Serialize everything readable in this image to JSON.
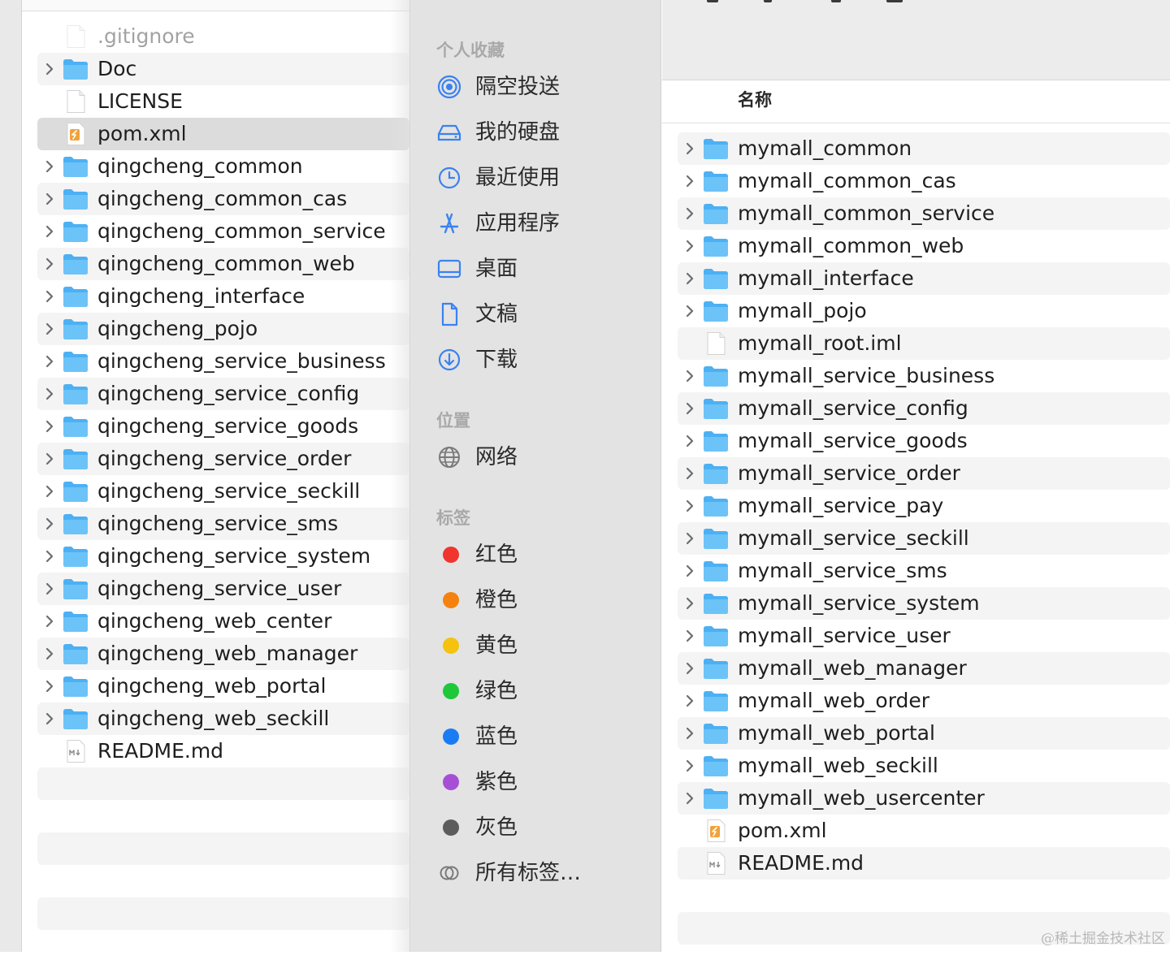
{
  "left_list": {
    "rows": [
      {
        "name": ".gitignore",
        "type": "file",
        "dim": true
      },
      {
        "name": "Doc",
        "type": "folder"
      },
      {
        "name": "LICENSE",
        "type": "file"
      },
      {
        "name": "pom.xml",
        "type": "xml",
        "selected": true
      },
      {
        "name": "qingcheng_common",
        "type": "folder"
      },
      {
        "name": "qingcheng_common_cas",
        "type": "folder"
      },
      {
        "name": "qingcheng_common_service",
        "type": "folder"
      },
      {
        "name": "qingcheng_common_web",
        "type": "folder"
      },
      {
        "name": "qingcheng_interface",
        "type": "folder"
      },
      {
        "name": "qingcheng_pojo",
        "type": "folder"
      },
      {
        "name": "qingcheng_service_business",
        "type": "folder"
      },
      {
        "name": "qingcheng_service_config",
        "type": "folder"
      },
      {
        "name": "qingcheng_service_goods",
        "type": "folder"
      },
      {
        "name": "qingcheng_service_order",
        "type": "folder"
      },
      {
        "name": "qingcheng_service_seckill",
        "type": "folder"
      },
      {
        "name": "qingcheng_service_sms",
        "type": "folder"
      },
      {
        "name": "qingcheng_service_system",
        "type": "folder"
      },
      {
        "name": "qingcheng_service_user",
        "type": "folder"
      },
      {
        "name": "qingcheng_web_center",
        "type": "folder"
      },
      {
        "name": "qingcheng_web_manager",
        "type": "folder"
      },
      {
        "name": "qingcheng_web_portal",
        "type": "folder"
      },
      {
        "name": "qingcheng_web_seckill",
        "type": "folder"
      },
      {
        "name": "README.md",
        "type": "md"
      }
    ]
  },
  "sidebar": {
    "favorites_title": "个人收藏",
    "favorites": [
      {
        "label": "隔空投送",
        "icon": "airdrop-icon"
      },
      {
        "label": "我的硬盘",
        "icon": "hard-drive-icon"
      },
      {
        "label": "最近使用",
        "icon": "clock-icon"
      },
      {
        "label": "应用程序",
        "icon": "applications-icon"
      },
      {
        "label": "桌面",
        "icon": "desktop-icon"
      },
      {
        "label": "文稿",
        "icon": "document-icon"
      },
      {
        "label": "下载",
        "icon": "download-icon"
      }
    ],
    "locations_title": "位置",
    "locations": [
      {
        "label": "网络",
        "icon": "network-globe-icon"
      }
    ],
    "tags_title": "标签",
    "tags": [
      {
        "label": "红色",
        "color": "#f0342e"
      },
      {
        "label": "橙色",
        "color": "#f5820f"
      },
      {
        "label": "黄色",
        "color": "#f5c20f"
      },
      {
        "label": "绿色",
        "color": "#1ec83a"
      },
      {
        "label": "蓝色",
        "color": "#1a7cf5"
      },
      {
        "label": "紫色",
        "color": "#a64fd6"
      },
      {
        "label": "灰色",
        "color": "#5c5c5c"
      }
    ],
    "all_tags_label": "所有标签…"
  },
  "right_list": {
    "column_header": "名称",
    "rows": [
      {
        "name": "mymall_common",
        "type": "folder"
      },
      {
        "name": "mymall_common_cas",
        "type": "folder"
      },
      {
        "name": "mymall_common_service",
        "type": "folder"
      },
      {
        "name": "mymall_common_web",
        "type": "folder"
      },
      {
        "name": "mymall_interface",
        "type": "folder"
      },
      {
        "name": "mymall_pojo",
        "type": "folder"
      },
      {
        "name": "mymall_root.iml",
        "type": "file"
      },
      {
        "name": "mymall_service_business",
        "type": "folder"
      },
      {
        "name": "mymall_service_config",
        "type": "folder"
      },
      {
        "name": "mymall_service_goods",
        "type": "folder"
      },
      {
        "name": "mymall_service_order",
        "type": "folder"
      },
      {
        "name": "mymall_service_pay",
        "type": "folder"
      },
      {
        "name": "mymall_service_seckill",
        "type": "folder"
      },
      {
        "name": "mymall_service_sms",
        "type": "folder"
      },
      {
        "name": "mymall_service_system",
        "type": "folder"
      },
      {
        "name": "mymall_service_user",
        "type": "folder"
      },
      {
        "name": "mymall_web_manager",
        "type": "folder"
      },
      {
        "name": "mymall_web_order",
        "type": "folder"
      },
      {
        "name": "mymall_web_portal",
        "type": "folder"
      },
      {
        "name": "mymall_web_seckill",
        "type": "folder"
      },
      {
        "name": "mymall_web_usercenter",
        "type": "folder"
      },
      {
        "name": "pom.xml",
        "type": "xml"
      },
      {
        "name": "README.md",
        "type": "md"
      }
    ]
  },
  "watermark": "@稀土掘金技术社区",
  "colors": {
    "folder_blue": "#4db0f3",
    "sidebar_icon_blue": "#3a82f0",
    "selected_row": "#dcdcdc",
    "stripe": "#f4f4f4"
  }
}
